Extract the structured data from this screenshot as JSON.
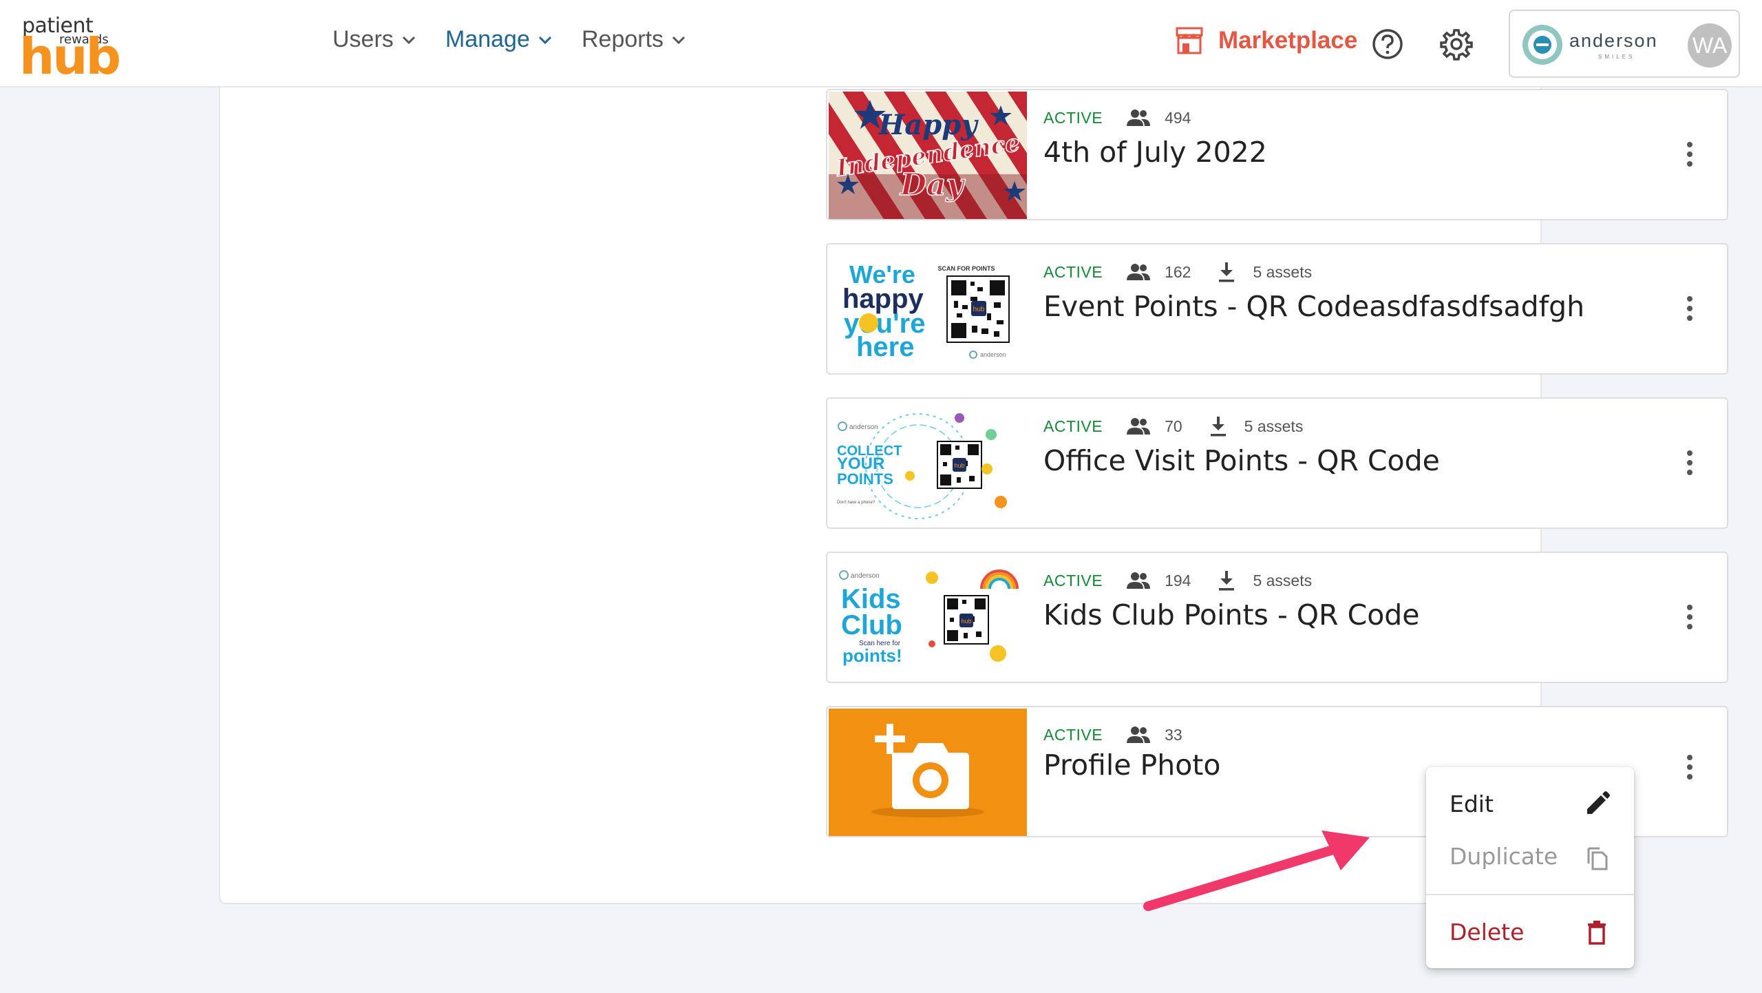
{
  "logo": {
    "line1": "patient",
    "line2": "rewards",
    "line3": "hub"
  },
  "nav": [
    {
      "label": "Users"
    },
    {
      "label": "Manage"
    },
    {
      "label": "Reports"
    }
  ],
  "header": {
    "marketplace_label": "Marketplace",
    "account_brand": "anderson",
    "account_brand_sub": "SMILES",
    "avatar_initials": "WA"
  },
  "campaigns": [
    {
      "status": "ACTIVE",
      "users": "494",
      "assets": "",
      "title": "4th of July 2022",
      "thumb_text": "Happy Independence Day"
    },
    {
      "status": "ACTIVE",
      "users": "162",
      "assets": "5 assets",
      "title": "Event Points - QR Codeasdfasdfsadfgh",
      "thumb_text": "We're happy you're here"
    },
    {
      "status": "ACTIVE",
      "users": "70",
      "assets": "5 assets",
      "title": "Office Visit Points - QR Code",
      "thumb_text": "COLLECT YOUR POINTS"
    },
    {
      "status": "ACTIVE",
      "users": "194",
      "assets": "5 assets",
      "title": "Kids Club Points - QR Code",
      "thumb_text": "Kids Club"
    },
    {
      "status": "ACTIVE",
      "users": "33",
      "assets": "",
      "title": "Profile Photo",
      "thumb_text": ""
    }
  ],
  "menu": {
    "edit": "Edit",
    "duplicate": "Duplicate",
    "delete": "Delete"
  },
  "colors": {
    "accent_blue": "#1f6592",
    "active_green": "#138a36",
    "marketplace": "#e45742",
    "delete_red": "#b0202a",
    "logo_orange": "#f6921e",
    "arrow_pink": "#f0386b"
  }
}
